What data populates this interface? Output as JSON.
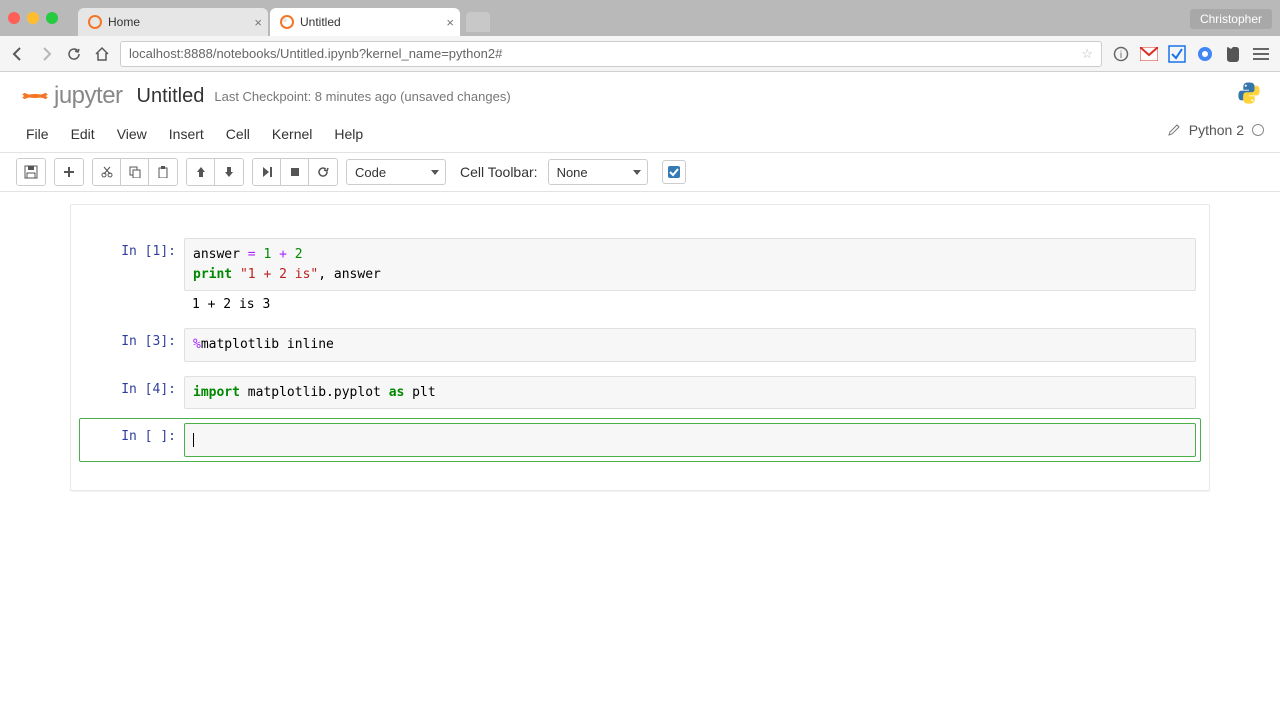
{
  "browser": {
    "user": "Christopher",
    "tabs": [
      {
        "title": "Home"
      },
      {
        "title": "Untitled"
      }
    ],
    "url": "localhost:8888/notebooks/Untitled.ipynb?kernel_name=python2#"
  },
  "notebook": {
    "logo_text": "jupyter",
    "title": "Untitled",
    "checkpoint": "Last Checkpoint: 8 minutes ago (unsaved changes)",
    "kernel_name": "Python 2"
  },
  "menu": {
    "items": [
      "File",
      "Edit",
      "View",
      "Insert",
      "Cell",
      "Kernel",
      "Help"
    ]
  },
  "toolbar": {
    "cell_type_select": "Code",
    "cell_toolbar_label": "Cell Toolbar:",
    "cell_toolbar_select": "None"
  },
  "cells": [
    {
      "prompt": "In [1]:",
      "source_lines": [
        {
          "tokens": [
            [
              "var",
              "answer"
            ],
            [
              "plain",
              " "
            ],
            [
              "op",
              "="
            ],
            [
              "plain",
              " "
            ],
            [
              "num",
              "1"
            ],
            [
              "plain",
              " "
            ],
            [
              "op",
              "+"
            ],
            [
              "plain",
              " "
            ],
            [
              "num",
              "2"
            ]
          ]
        },
        {
          "tokens": [
            [
              "kw",
              "print"
            ],
            [
              "plain",
              " "
            ],
            [
              "str",
              "\"1 + 2 is\""
            ],
            [
              "plain",
              ", answer"
            ]
          ]
        }
      ],
      "output": "1 + 2 is 3"
    },
    {
      "prompt": "In [3]:",
      "source_lines": [
        {
          "tokens": [
            [
              "mag",
              "%"
            ],
            [
              "plain",
              "matplotlib inline"
            ]
          ]
        }
      ]
    },
    {
      "prompt": "In [4]:",
      "source_lines": [
        {
          "tokens": [
            [
              "impkw",
              "import"
            ],
            [
              "plain",
              " matplotlib.pyplot "
            ],
            [
              "impkw",
              "as"
            ],
            [
              "plain",
              " plt"
            ]
          ]
        }
      ]
    },
    {
      "prompt": "In [ ]:",
      "selected": true,
      "source_lines": [
        {
          "tokens": []
        }
      ]
    }
  ]
}
